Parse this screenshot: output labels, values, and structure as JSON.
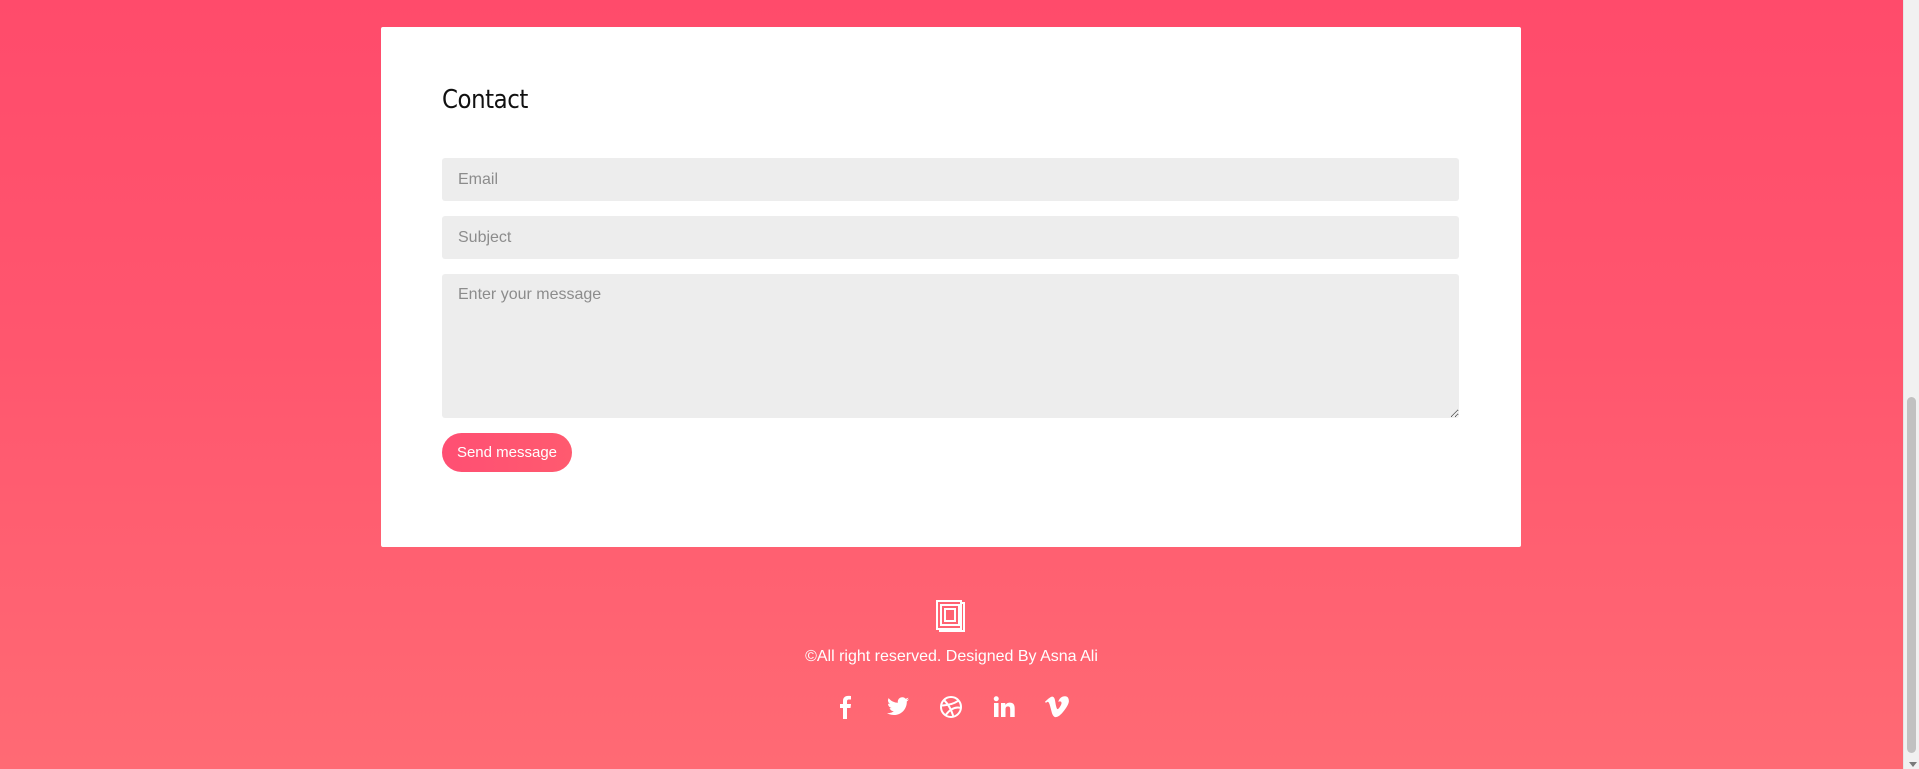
{
  "contact": {
    "title": "Contact",
    "email_placeholder": "Email",
    "subject_placeholder": "Subject",
    "message_placeholder": "Enter your message",
    "send_label": "Send message"
  },
  "footer": {
    "logo_icon": "book-icon",
    "copyright": "©All right reserved. Designed By Asna Ali",
    "social": [
      {
        "icon": "facebook-icon"
      },
      {
        "icon": "twitter-icon"
      },
      {
        "icon": "dribbble-icon"
      },
      {
        "icon": "linkedin-icon"
      },
      {
        "icon": "vimeo-icon"
      }
    ]
  },
  "colors": {
    "background_top": "#ff4b6b",
    "background_bottom": "#ff6a74",
    "card": "#ffffff",
    "field": "#ededed",
    "accent": "#ff4f73"
  }
}
